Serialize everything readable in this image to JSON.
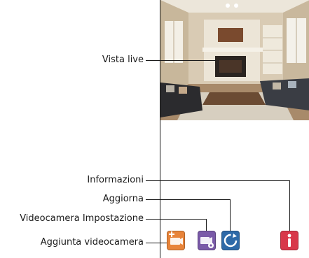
{
  "callouts": {
    "live_view": "Vista live",
    "info": "Informazioni",
    "refresh": "Aggiorna",
    "camera_settings": "Videocamera Impostazione",
    "add_camera": "Aggiunta videocamera"
  },
  "toolbar": {
    "buttons": [
      {
        "icon": "add-camera-icon",
        "color": "#e8843a"
      },
      {
        "icon": "camera-settings-icon",
        "color": "#7a5aa8"
      },
      {
        "icon": "refresh-icon",
        "color": "#2f6aa8"
      },
      {
        "icon": "info-icon",
        "color": "#d8384a"
      }
    ]
  }
}
